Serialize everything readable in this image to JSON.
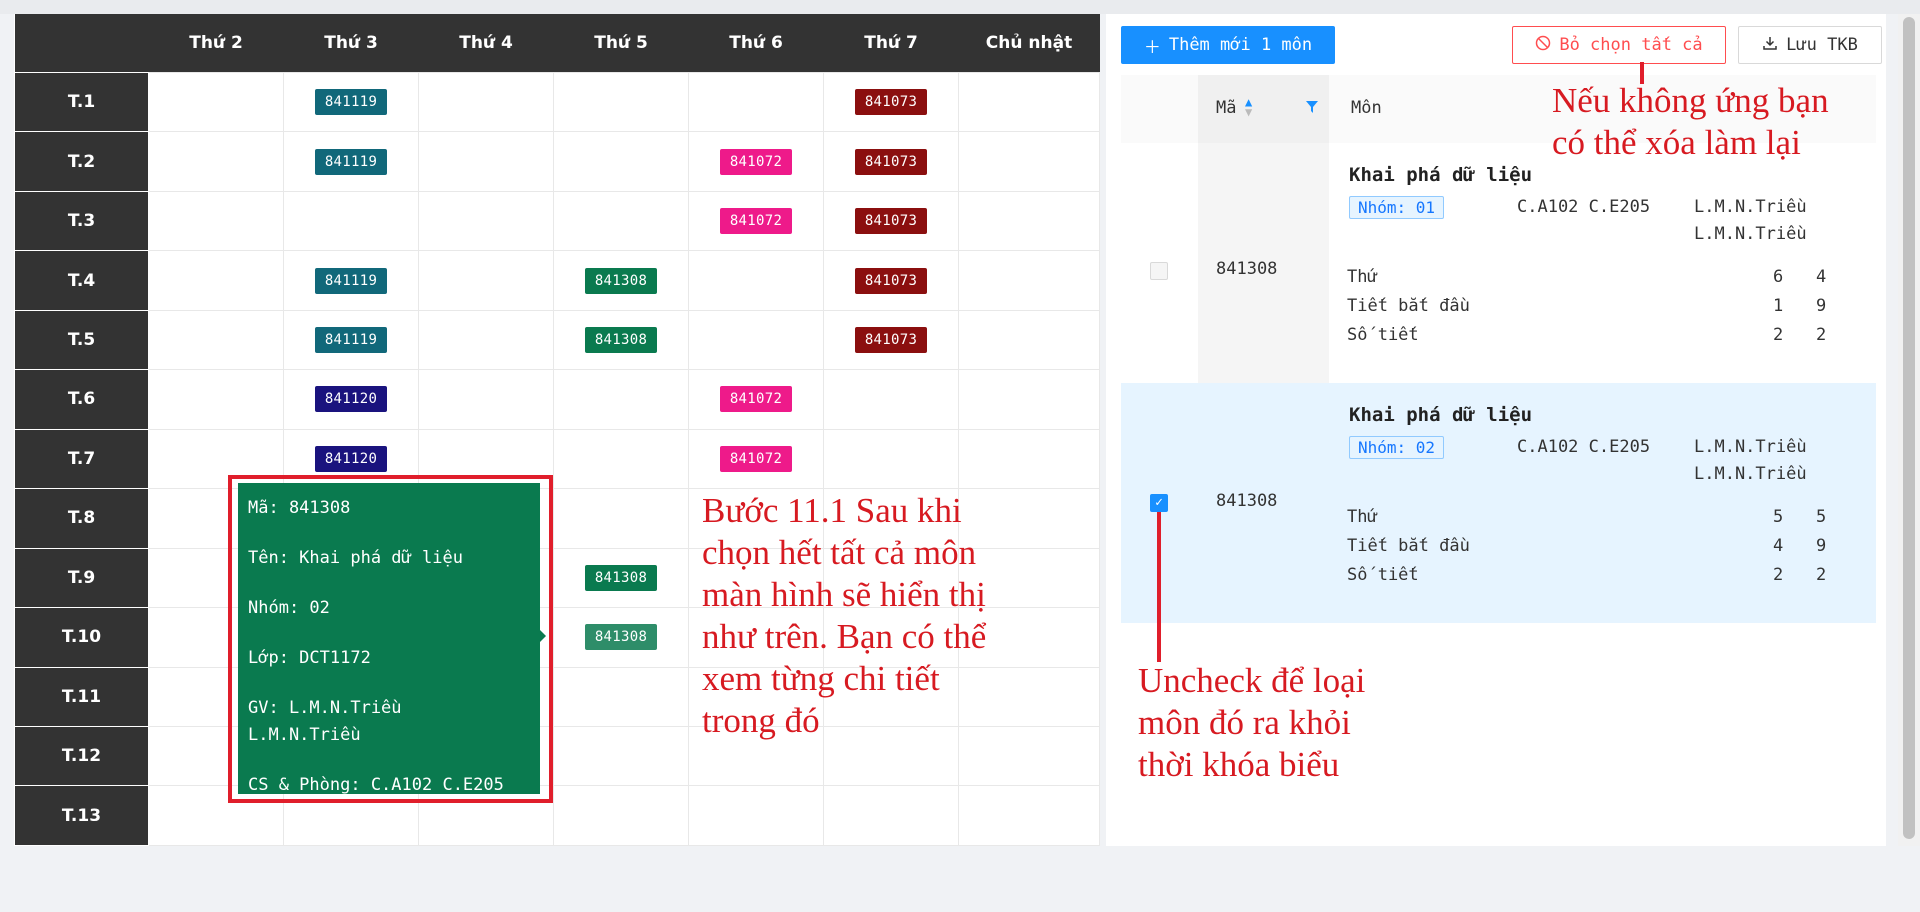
{
  "timetable": {
    "days": [
      "Thứ 2",
      "Thứ 3",
      "Thứ 4",
      "Thứ 5",
      "Thứ 6",
      "Thứ 7",
      "Chủ nhật"
    ],
    "periods": [
      "T.1",
      "T.2",
      "T.3",
      "T.4",
      "T.5",
      "T.6",
      "T.7",
      "T.8",
      "T.9",
      "T.10",
      "T.11",
      "T.12",
      "T.13"
    ],
    "course_colors": {
      "841119": "#11687a",
      "841073": "#8b0f0f",
      "841072": "#ee1a8a",
      "841308": "#0a7a4f",
      "841120": "#1a137e"
    },
    "cells": [
      {
        "period": 0,
        "day": 1,
        "code": "841119"
      },
      {
        "period": 0,
        "day": 5,
        "code": "841073"
      },
      {
        "period": 1,
        "day": 1,
        "code": "841119"
      },
      {
        "period": 1,
        "day": 4,
        "code": "841072"
      },
      {
        "period": 1,
        "day": 5,
        "code": "841073"
      },
      {
        "period": 2,
        "day": 4,
        "code": "841072"
      },
      {
        "period": 2,
        "day": 5,
        "code": "841073"
      },
      {
        "period": 3,
        "day": 1,
        "code": "841119"
      },
      {
        "period": 3,
        "day": 3,
        "code": "841308"
      },
      {
        "period": 3,
        "day": 5,
        "code": "841073"
      },
      {
        "period": 4,
        "day": 1,
        "code": "841119"
      },
      {
        "period": 4,
        "day": 3,
        "code": "841308"
      },
      {
        "period": 4,
        "day": 5,
        "code": "841073"
      },
      {
        "period": 5,
        "day": 1,
        "code": "841120"
      },
      {
        "period": 5,
        "day": 4,
        "code": "841072"
      },
      {
        "period": 6,
        "day": 1,
        "code": "841120"
      },
      {
        "period": 6,
        "day": 4,
        "code": "841072"
      },
      {
        "period": 8,
        "day": 3,
        "code": "841308"
      },
      {
        "period": 9,
        "day": 3,
        "code": "841308",
        "hover": true
      }
    ]
  },
  "tooltip": {
    "ma": "Mã: 841308",
    "ten": "Tên: Khai phá dữ liệu",
    "nhom": "Nhóm: 02",
    "lop": "Lớp: DCT1172",
    "gv1": "GV: L.M.N.Triều",
    "gv2": "L.M.N.Triều",
    "phong": "CS & Phòng: C.A102 C.E205"
  },
  "notes": {
    "step": "Bước 11.1 Sau khi chọn hết tất cả môn màn hình sẽ hiển thị như trên. Bạn có thể xem từng chi tiết trong đó",
    "clear": "Nếu không ứng bạn có thể xóa làm lại",
    "uncheck": "Uncheck để loại môn đó ra khỏi thời khóa biểu"
  },
  "toolbar": {
    "add_label": "Thêm mới 1 môn",
    "clear_label": "Bỏ chọn tất cả",
    "save_label": "Lưu TKB"
  },
  "list": {
    "col_ma": "Mã",
    "col_mon": "Môn",
    "row_labels": {
      "thu": "Thứ",
      "tiet_bat_dau": "Tiết bắt đầu",
      "so_tiet": "Số tiết"
    },
    "courses": [
      {
        "checked": false,
        "ma": "841308",
        "name": "Khai phá dữ liệu",
        "nhom": "Nhóm: 01",
        "phong": "C.A102 C.E205",
        "gv1": "L.M.N.Triều",
        "gv2": "L.M.N.Triều",
        "thu": [
          "6",
          "4"
        ],
        "tiet_bat_dau": [
          "1",
          "9"
        ],
        "so_tiet": [
          "2",
          "2"
        ]
      },
      {
        "checked": true,
        "ma": "841308",
        "name": "Khai phá dữ liệu",
        "nhom": "Nhóm: 02",
        "phong": "C.A102 C.E205",
        "gv1": "L.M.N.Triều",
        "gv2": "L.M.N.Triều",
        "thu": [
          "5",
          "5"
        ],
        "tiet_bat_dau": [
          "4",
          "9"
        ],
        "so_tiet": [
          "2",
          "2"
        ]
      }
    ]
  }
}
